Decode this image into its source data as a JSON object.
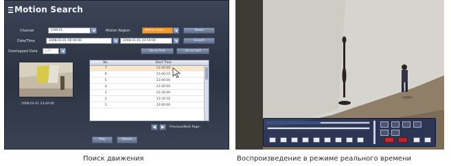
{
  "left": {
    "title": "Motion Search",
    "channel_label": "Channel",
    "channel_value": "CAM 01",
    "motion_region_label": "Motion Region",
    "motion_region_value": "Motion Area",
    "reset_button": "Reset",
    "datetime_label": "Date/Time",
    "date_from": "2008-01-01 00:00:00",
    "date_to": "2008-01-01 23:59:00",
    "search_button": "Search",
    "overlapped_label": "Overlapped Data",
    "overlapped_value": "LIST",
    "go_first_button": "Go to First",
    "go_last_button": "Go to Last",
    "thumb_caption": "2008-01-01 23:40:00",
    "columns": {
      "no": "No.",
      "start_time": "Start Time"
    },
    "rows": [
      {
        "no": "7",
        "time": "23:40:00"
      },
      {
        "no": "6",
        "time": "23:40:10"
      },
      {
        "no": "5",
        "time": "23:40:00"
      },
      {
        "no": "4",
        "time": "23:30:00"
      },
      {
        "no": "3",
        "time": "23:30:00"
      },
      {
        "no": "2",
        "time": "23:30:10"
      },
      {
        "no": "1",
        "time": "23:00:00"
      }
    ],
    "pagination_label": "Previous/Next Page",
    "play_button": "Play",
    "return_button": "Return"
  },
  "captions": {
    "left": "Поиск движения",
    "right": "Воспроизведение в режиме реального времени"
  },
  "colors": {
    "dialog_bg": "#2f3646",
    "accent_orange": "#f29a2e",
    "selected_row": "#fbe7cc",
    "playbar_bg": "#222e54",
    "record_red": "#c42a2a"
  },
  "playback": {
    "progress": 0.52
  }
}
